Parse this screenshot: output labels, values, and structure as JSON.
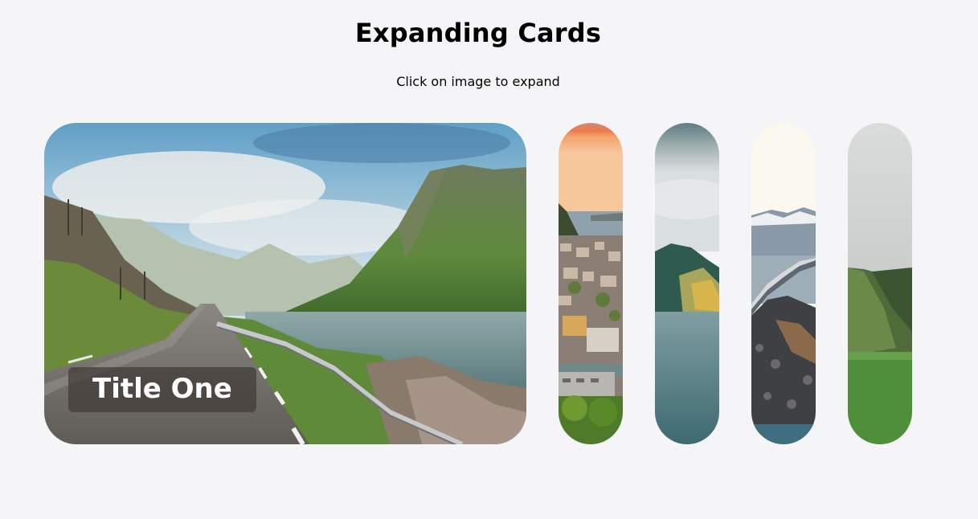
{
  "header": {
    "title": "Expanding Cards",
    "subtitle": "Click on image to expand"
  },
  "cards": [
    {
      "title": "Title One",
      "active": true,
      "scene": "coastal-road-mountain-fjord"
    },
    {
      "title": "",
      "active": false,
      "scene": "sunset-town-harbor"
    },
    {
      "title": "",
      "active": false,
      "scene": "misty-lake-mountains"
    },
    {
      "title": "",
      "active": false,
      "scene": "ocean-road-bridge"
    },
    {
      "title": "",
      "active": false,
      "scene": "green-hills-fog"
    }
  ]
}
